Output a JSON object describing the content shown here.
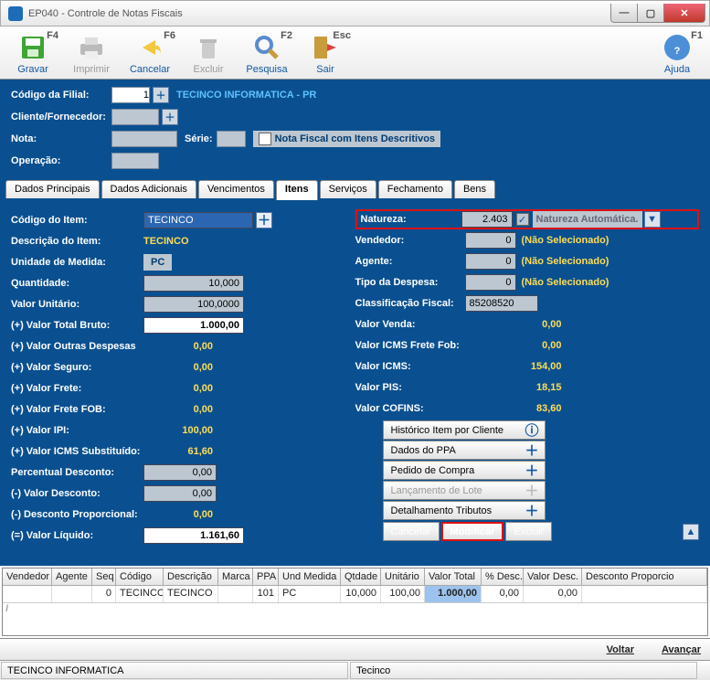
{
  "window": {
    "title": "EP040 - Controle de Notas Fiscais"
  },
  "toolbar": {
    "gravar": {
      "label": "Gravar",
      "shortcut": "F4"
    },
    "imprimir": {
      "label": "Imprimir"
    },
    "cancelar": {
      "label": "Cancelar",
      "shortcut": "F6"
    },
    "excluir": {
      "label": "Excluir"
    },
    "pesquisa": {
      "label": "Pesquisa",
      "shortcut": "F2"
    },
    "sair": {
      "label": "Sair",
      "shortcut": "Esc"
    },
    "ajuda": {
      "label": "Ajuda",
      "shortcut": "F1"
    }
  },
  "header": {
    "codigo_filial_label": "Código da Filial:",
    "codigo_filial_value": "1",
    "filial_nome": "TECINCO INFORMATICA - PR",
    "cliente_label": "Cliente/Fornecedor:",
    "nota_label": "Nota:",
    "serie_label": "Série:",
    "descritivo_label": "Nota Fiscal com Itens Descritivos",
    "operacao_label": "Operação:"
  },
  "tabs": [
    "Dados Principais",
    "Dados Adicionais",
    "Vencimentos",
    "Itens",
    "Serviços",
    "Fechamento",
    "Bens"
  ],
  "active_tab": "Itens",
  "item": {
    "codigo_label": "Código do Item:",
    "codigo_value": "TECINCO",
    "descricao_label": "Descrição do Item:",
    "descricao_value": "TECINCO",
    "unidade_label": "Unidade de Medida:",
    "unidade_value": "PC",
    "quantidade_label": "Quantidade:",
    "quantidade_value": "10,000",
    "valor_unitario_label": "Valor Unitário:",
    "valor_unitario_value": "100,0000",
    "total_bruto_label": "(+) Valor Total Bruto:",
    "total_bruto_value": "1.000,00",
    "outras_desp_label": "(+) Valor Outras Despesas",
    "outras_desp_value": "0,00",
    "seguro_label": "(+) Valor Seguro:",
    "seguro_value": "0,00",
    "frete_label": "(+) Valor Frete:",
    "frete_value": "0,00",
    "frete_fob_label": "(+) Valor Frete FOB:",
    "frete_fob_value": "0,00",
    "ipi_label": "(+) Valor IPI:",
    "ipi_value": "100,00",
    "icms_sub_label": "(+) Valor ICMS Substituído:",
    "icms_sub_value": "61,60",
    "perc_desc_label": "Percentual Desconto:",
    "perc_desc_value": "0,00",
    "val_desc_label": "(-) Valor Desconto:",
    "val_desc_value": "0,00",
    "desc_prop_label": "(-) Desconto Proporcional:",
    "desc_prop_value": "0,00",
    "liquido_label": "(=) Valor Líquido:",
    "liquido_value": "1.161,60"
  },
  "right": {
    "natureza_label": "Natureza:",
    "natureza_value": "2.403",
    "natureza_auto": "Natureza Automática.",
    "vendedor_label": "Vendedor:",
    "vendedor_value": "0",
    "vendedor_desc": "(Não Selecionado)",
    "agente_label": "Agente:",
    "agente_value": "0",
    "agente_desc": "(Não Selecionado)",
    "tipo_desp_label": "Tipo da Despesa:",
    "tipo_desp_value": "0",
    "tipo_desp_desc": "(Não Selecionado)",
    "class_fiscal_label": "Classificação Fiscal:",
    "class_fiscal_value": "85208520",
    "valor_venda_label": "Valor Venda:",
    "valor_venda_value": "0,00",
    "icms_fob_label": "Valor ICMS Frete Fob:",
    "icms_fob_value": "0,00",
    "icms_label": "Valor ICMS:",
    "icms_value": "154,00",
    "pis_label": "Valor PIS:",
    "pis_value": "18,15",
    "cofins_label": "Valor COFINS:",
    "cofins_value": "83,60",
    "actions": {
      "historico": "Histórico Item por Cliente",
      "ppa": "Dados do PPA",
      "pedido": "Pedido de Compra",
      "lancamento": "Lançamento de Lote",
      "tributos": "Detalhamento Tributos",
      "cancelar": "Cancelar",
      "modificar": "Modificar",
      "excluir": "Excluir"
    }
  },
  "grid": {
    "headers": [
      "Vendedor",
      "Agente",
      "Seq",
      "Código",
      "Descrição",
      "Marca",
      "PPA",
      "Und Medida",
      "Qtdade",
      "Unitário",
      "Valor Total",
      "% Desc.",
      "Valor Desc.",
      "Desconto Proporcio"
    ],
    "row": {
      "vendedor": "",
      "agente": "",
      "seq": "0",
      "codigo": "TECINCO",
      "descricao": "TECINCO",
      "marca": "",
      "ppa": "101",
      "und": "PC",
      "qtd": "10,000",
      "unit": "100,00",
      "total": "1.000,00",
      "pdesc": "0,00",
      "vdesc": "0,00",
      "dprop": ""
    },
    "add_marker": "I"
  },
  "nav": {
    "voltar": "Voltar",
    "avancar": "Avançar"
  },
  "status": {
    "empresa": "TECINCO INFORMATICA",
    "usuario": "Tecinco"
  }
}
